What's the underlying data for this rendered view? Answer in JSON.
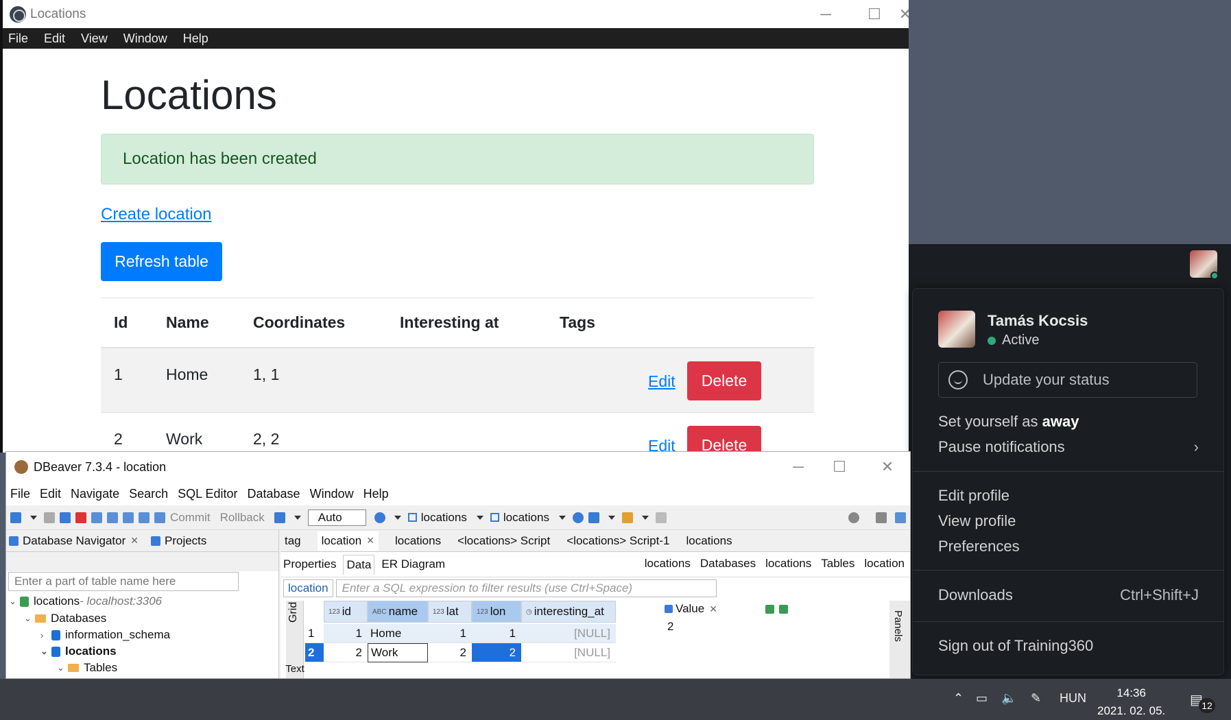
{
  "app_window": {
    "title": "Locations",
    "menu": [
      "File",
      "Edit",
      "View",
      "Window",
      "Help"
    ],
    "controls": {
      "minimize": "─",
      "maximize": "☐",
      "close": "✕"
    }
  },
  "page": {
    "heading": "Locations",
    "alert": "Location has been created",
    "create_link": "Create location",
    "refresh_button": "Refresh table",
    "table": {
      "headers": [
        "Id",
        "Name",
        "Coordinates",
        "Interesting at",
        "Tags"
      ],
      "rows": [
        {
          "id": "1",
          "name": "Home",
          "coordinates": "1, 1",
          "edit": "Edit",
          "delete": "Delete"
        },
        {
          "id": "2",
          "name": "Work",
          "coordinates": "2, 2",
          "edit": "Edit",
          "delete": "Delete"
        }
      ]
    }
  },
  "slack_menu": {
    "user_name": "Tamás Kocsis",
    "status": "Active",
    "update_status": "Update your status",
    "away_prefix": "Set yourself as ",
    "away_bold": "away",
    "pause": "Pause notifications",
    "pause_chevron": "›",
    "edit_profile": "Edit profile",
    "view_profile": "View profile",
    "preferences": "Preferences",
    "downloads": "Downloads",
    "downloads_shortcut": "Ctrl+Shift+J",
    "sign_out": "Sign out of Training360"
  },
  "dbeaver": {
    "title": "DBeaver 7.3.4 - location",
    "menu": [
      "File",
      "Edit",
      "Navigate",
      "Search",
      "SQL Editor",
      "Database",
      "Window",
      "Help"
    ],
    "toolbar": {
      "commit": "Commit",
      "rollback": "Rollback",
      "auto": "Auto",
      "ds1": "locations",
      "ds2": "locations"
    },
    "nav_tabs": {
      "navigator": "Database Navigator",
      "projects": "Projects"
    },
    "nav_search_placeholder": "Enter a part of table name here",
    "tree": {
      "connection": "locations",
      "connection_host": " - localhost:3306",
      "databases": "Databases",
      "schema1": "information_schema",
      "schema2": "locations",
      "tables": "Tables"
    },
    "editor_tabs": [
      "tag",
      "location",
      "locations",
      "<locations> Script",
      "<locations> Script-1",
      "locations"
    ],
    "sub_tabs": [
      "Properties",
      "Data",
      "ER Diagram"
    ],
    "crumbs": [
      "locations",
      "Databases",
      "locations",
      "Tables",
      "location"
    ],
    "filter_tag": "location",
    "filter_placeholder": "Enter a SQL expression to filter results (use Ctrl+Space)",
    "grid_tab": "Grid",
    "columns": [
      {
        "type": "123",
        "name": "id"
      },
      {
        "type": "ABC",
        "name": "name"
      },
      {
        "type": "123",
        "name": "lat"
      },
      {
        "type": "123",
        "name": "lon"
      },
      {
        "type": "",
        "name": "interesting_at"
      }
    ],
    "rows": [
      {
        "n": "1",
        "id": "1",
        "name": "Home",
        "lat": "1",
        "lon": "1",
        "interesting_at": "[NULL]"
      },
      {
        "n": "2",
        "id": "2",
        "name": "Work",
        "lat": "2",
        "lon": "2",
        "interesting_at": "[NULL]"
      }
    ],
    "value_panel_title": "Value",
    "value_panel_value": "2",
    "panels_label": "Panels",
    "text_tab": "Text"
  },
  "taskbar": {
    "lang": "HUN",
    "time": "14:36",
    "date": "2021. 02. 05.",
    "notifications": "12"
  },
  "colors": {
    "primary": "#007bff",
    "danger": "#dc3545",
    "alert_bg": "#d4edda",
    "slack_bg": "#1a1d21",
    "active": "#2bac76"
  }
}
